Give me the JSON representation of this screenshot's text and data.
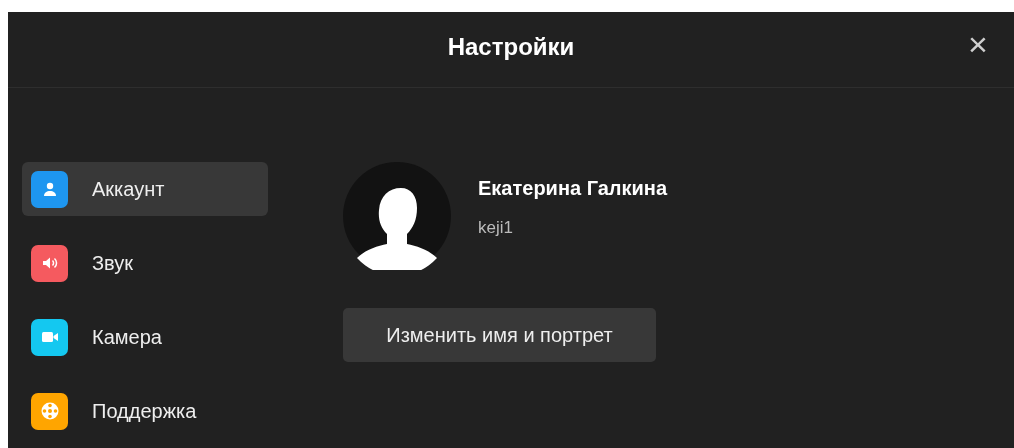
{
  "window": {
    "title": "Настройки",
    "close": "×"
  },
  "sidebar": {
    "items": [
      {
        "label": "Аккаунт",
        "kind": "account",
        "color": "#1e96f0",
        "selected": true
      },
      {
        "label": "Звук",
        "kind": "sound",
        "color": "#f55a5f",
        "selected": false
      },
      {
        "label": "Камера",
        "kind": "camera",
        "color": "#14c8f0",
        "selected": false
      },
      {
        "label": "Поддержка",
        "kind": "support",
        "color": "#ffa500",
        "selected": false
      }
    ]
  },
  "profile": {
    "name": "Екатерина Галкина",
    "login": "keji1",
    "edit_button": "Изменить имя и портрет"
  }
}
